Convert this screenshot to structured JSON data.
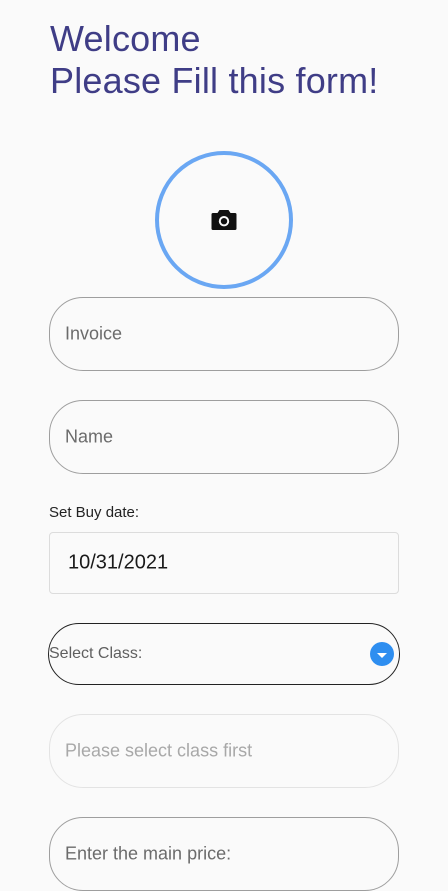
{
  "header": {
    "line1": "Welcome",
    "line2": "Please Fill this form!"
  },
  "photo": {
    "icon": "camera-icon",
    "ring_color": "#6aa7f3"
  },
  "form": {
    "invoice_placeholder": "Invoice",
    "name_placeholder": "Name",
    "buy_date_label": "Set Buy date:",
    "buy_date_value": "10/31/2021",
    "class_label": "Select Class:",
    "class_dependent_placeholder": "Please select class first",
    "main_price_placeholder": "Enter the main price:"
  },
  "colors": {
    "title": "#3f3d86",
    "accent": "#2e8ef0"
  }
}
